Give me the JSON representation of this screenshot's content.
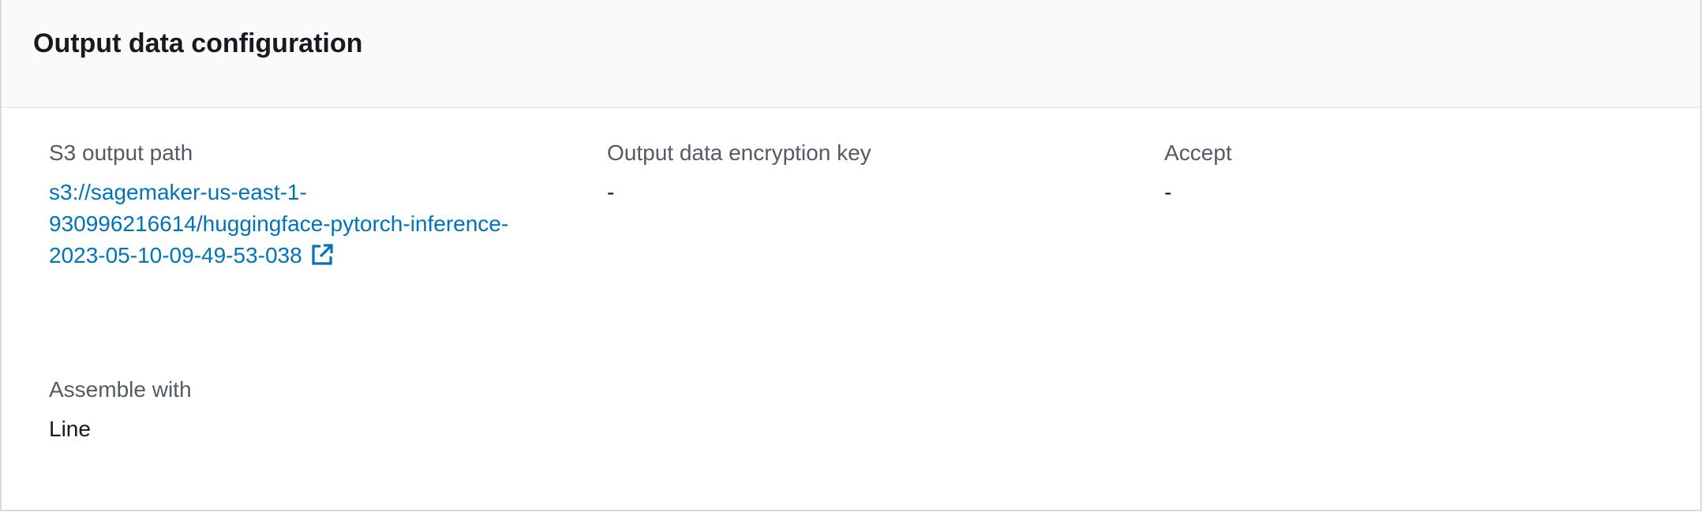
{
  "panel": {
    "title": "Output data configuration"
  },
  "fields": {
    "s3_output_path": {
      "label": "S3 output path",
      "value_line1": "s3://sagemaker-us-east-1-",
      "value_line2": "930996216614/huggingface-pytorch-inference-",
      "value_line3": "2023-05-10-09-49-53-038"
    },
    "encryption_key": {
      "label": "Output data encryption key",
      "value": "-"
    },
    "accept": {
      "label": "Accept",
      "value": "-"
    },
    "assemble_with": {
      "label": "Assemble with",
      "value": "Line"
    }
  },
  "colors": {
    "link": "#0073bb",
    "label": "#545b64",
    "text": "#16191f",
    "header_bg": "#fafafa"
  },
  "icons": {
    "external_link": "external-link-icon"
  }
}
